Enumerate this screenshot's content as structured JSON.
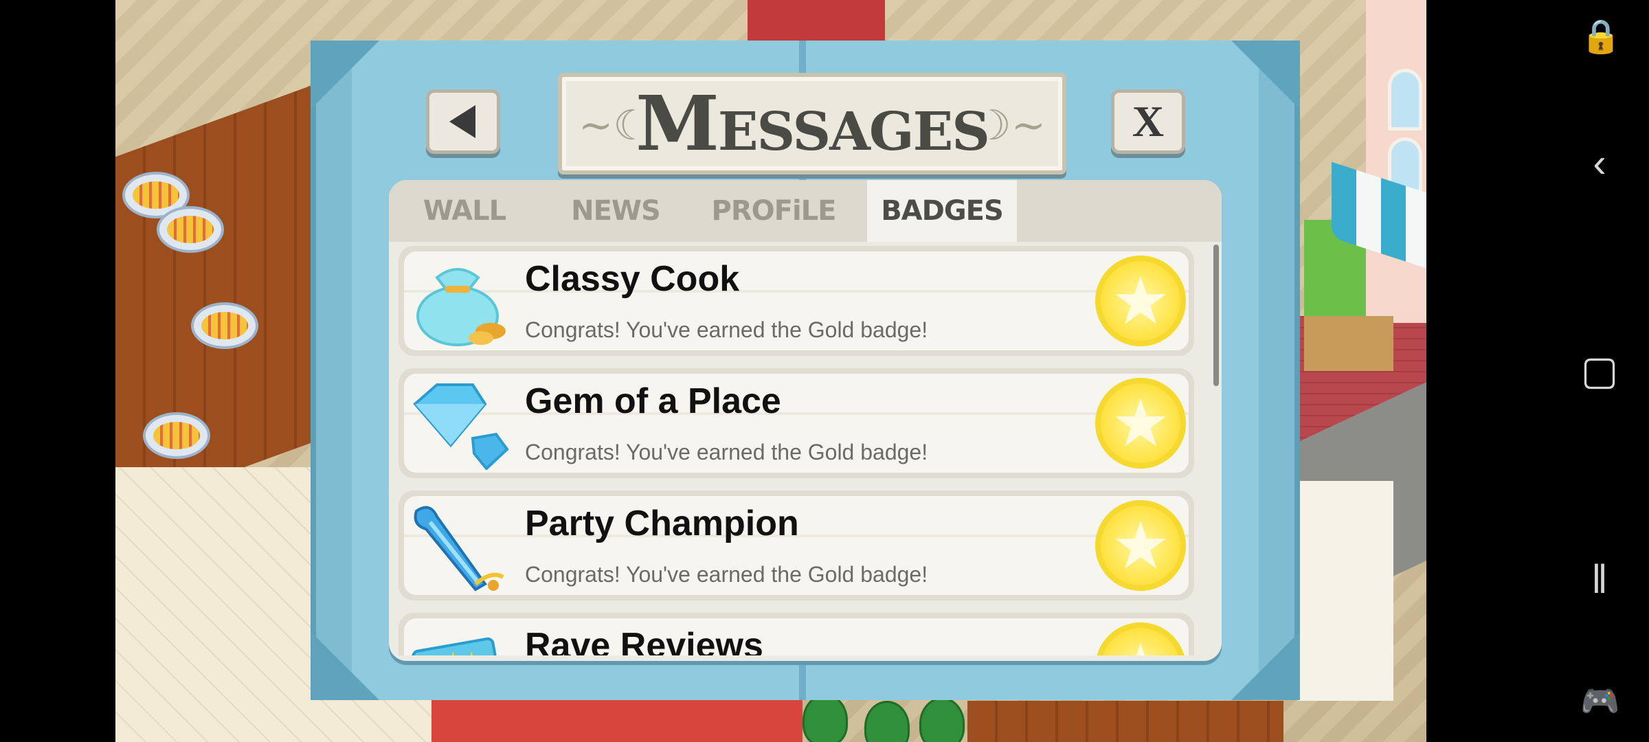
{
  "dialog": {
    "title": "Messages",
    "back_icon": "left-arrow-icon",
    "close_label": "X"
  },
  "tabs": [
    {
      "label": "WALL",
      "active": false
    },
    {
      "label": "NEWS",
      "active": false
    },
    {
      "label": "PROFiLE",
      "active": false
    },
    {
      "label": "BADGES",
      "active": true
    }
  ],
  "badges": [
    {
      "name": "Classy Cook",
      "message": "Congrats! You've earned the Gold badge!",
      "icon": "money-bag-icon",
      "level": "gold"
    },
    {
      "name": "Gem of a Place",
      "message": "Congrats! You've earned the Gold badge!",
      "icon": "diamond-icon",
      "level": "gold"
    },
    {
      "name": "Party Champion",
      "message": "Congrats! You've earned the Gold badge!",
      "icon": "party-horn-icon",
      "level": "gold"
    },
    {
      "name": "Rave Reviews",
      "message": "",
      "icon": "review-card-icon",
      "level": "gold"
    }
  ],
  "nav": {
    "icons": [
      "screen-lock-icon",
      "back-chevron-icon",
      "home-square-icon",
      "recents-icon",
      "gamepad-icon"
    ]
  },
  "colors": {
    "frame": "#7fbcd2",
    "medal": "#ffe44a"
  }
}
